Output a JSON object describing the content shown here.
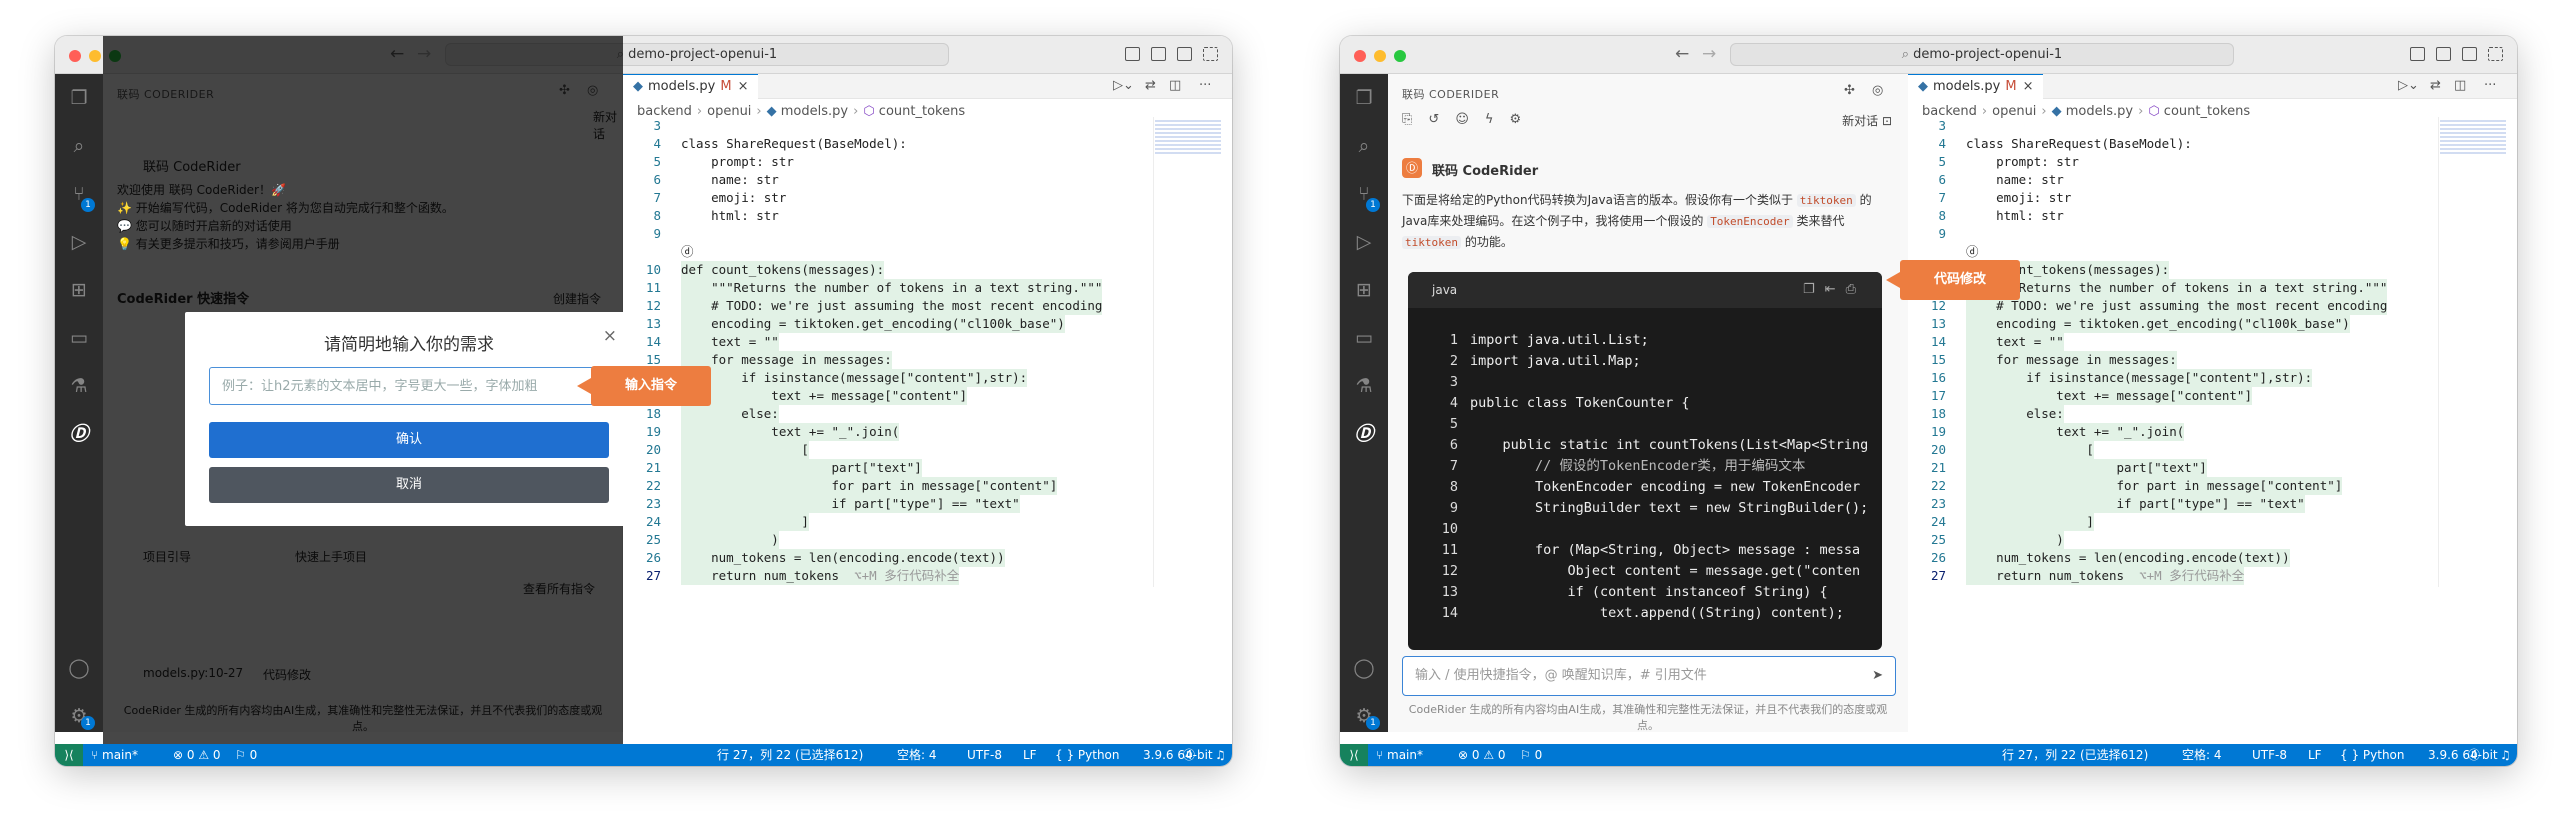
{
  "common": {
    "title": "demo-project-openui-1",
    "sidebar_header": "联码 CODERIDER",
    "tab": {
      "label": "models.py",
      "modified": "M"
    },
    "breadcrumb": [
      "backend",
      "openui",
      "models.py",
      "count_tokens"
    ],
    "code_lines": [
      {
        "n": "3",
        "t": ""
      },
      {
        "n": "4",
        "t": "class ShareRequest(BaseModel):"
      },
      {
        "n": "5",
        "t": "    prompt: str"
      },
      {
        "n": "6",
        "t": "    name: str"
      },
      {
        "n": "7",
        "t": "    emoji: str"
      },
      {
        "n": "8",
        "t": "    html: str"
      },
      {
        "n": "9",
        "t": ""
      },
      {
        "n": "",
        "t": "ⓓ"
      },
      {
        "n": "10",
        "t": "def count_tokens(messages):"
      },
      {
        "n": "11",
        "t": "    \"\"\"Returns the number of tokens in a text string.\"\"\""
      },
      {
        "n": "12",
        "t": "    # TODO: we're just assuming the most recent encoding"
      },
      {
        "n": "13",
        "t": "    encoding = tiktoken.get_encoding(\"cl100k_base\")"
      },
      {
        "n": "14",
        "t": "    text = \"\""
      },
      {
        "n": "15",
        "t": "    for message in messages:"
      },
      {
        "n": "16",
        "t": "        if isinstance(message[\"content\"],str):"
      },
      {
        "n": "17",
        "t": "            text += message[\"content\"]"
      },
      {
        "n": "18",
        "t": "        else:"
      },
      {
        "n": "19",
        "t": "            text += \"_\".join("
      },
      {
        "n": "20",
        "t": "                ["
      },
      {
        "n": "21",
        "t": "                    part[\"text\"]"
      },
      {
        "n": "22",
        "t": "                    for part in message[\"content\"]"
      },
      {
        "n": "23",
        "t": "                    if part[\"type\"] == \"text\""
      },
      {
        "n": "24",
        "t": "                ]"
      },
      {
        "n": "25",
        "t": "            )"
      },
      {
        "n": "26",
        "t": "    num_tokens = len(encoding.encode(text))"
      },
      {
        "n": "27",
        "t": "    return num_tokens"
      }
    ],
    "ghost_hint": "⌥+M 多行代码补全",
    "status": {
      "branch": "main*",
      "problems": "⊗ 0 ⚠ 0",
      "ports": "⚐ 0",
      "position": "行 27，列 22 (已选择612)",
      "spaces": "空格: 4",
      "encoding": "UTF-8",
      "eol": "LF",
      "language": "{ } Python",
      "interpreter": "3.9.6 64-bit"
    }
  },
  "left": {
    "dim_texts": [
      "新对话",
      "联码 CodeRider",
      "欢迎使用 联码 CodeRider！🚀",
      "✨ 开始编写代码，CodeRider 将为您自动完成行和整个函数。",
      "💬 您可以随时开启新的对话使用",
      "💡 有关更多提示和技巧，请参阅用户手册",
      "CodeRider 快速指令",
      "创建指令",
      "项目引导",
      "快速上手项目",
      "查看所有指令",
      "models.py:10-27",
      "代码修改",
      "CodeRider 生成的所有内容均由AI生成，其准确性和完整性无法保证，并且不代表我们的态度或观点。"
    ],
    "modal": {
      "title": "请简明地输入你的需求",
      "placeholder": "例子：让h2元素的文本居中，字号更大一些，字体加粗",
      "confirm": "确认",
      "cancel": "取消"
    },
    "callout": "输入指令"
  },
  "right": {
    "new_chat": "新对话",
    "brand": "联码 CodeRider",
    "message": "下面是将给定的Python代码转换为Java语言的版本。假设你有一个类似于 tiktoken 的Java库来处理编码。在这个例子中，我将使用一个假设的 TokenEncoder 类来替代 tiktoken 的功能。",
    "msg_parts": [
      "下面是将给定的Python代码转换为Java语言的版本。假设你有一个类似于",
      "tiktoken",
      "的Java库来处理编码。在这个例子中，我将使用一个假设的",
      "TokenEncoder",
      "类来替代",
      "tiktoken",
      "的功能。"
    ],
    "code_lang": "java",
    "java_lines": [
      {
        "n": "1",
        "t": "import java.util.List;"
      },
      {
        "n": "2",
        "t": "import java.util.Map;"
      },
      {
        "n": "3",
        "t": ""
      },
      {
        "n": "4",
        "t": "public class TokenCounter {"
      },
      {
        "n": "5",
        "t": ""
      },
      {
        "n": "6",
        "t": "    public static int countTokens(List<Map<String"
      },
      {
        "n": "7",
        "t": "        // 假设的TokenEncoder类，用于编码文本"
      },
      {
        "n": "8",
        "t": "        TokenEncoder encoding = new TokenEncoder"
      },
      {
        "n": "9",
        "t": "        StringBuilder text = new StringBuilder();"
      },
      {
        "n": "10",
        "t": ""
      },
      {
        "n": "11",
        "t": "        for (Map<String, Object> message : messa"
      },
      {
        "n": "12",
        "t": "            Object content = message.get(\"conten"
      },
      {
        "n": "13",
        "t": "            if (content instanceof String) {"
      },
      {
        "n": "14",
        "t": "                text.append((String) content);"
      }
    ],
    "input_placeholder": "输入 / 使用快捷指令，@ 唤醒知识库，# 引用文件",
    "disclaimer": "CodeRider 生成的所有内容均由AI生成，其准确性和完整性无法保证，并且不代表我们的态度或观点。",
    "callout": "代码修改"
  }
}
